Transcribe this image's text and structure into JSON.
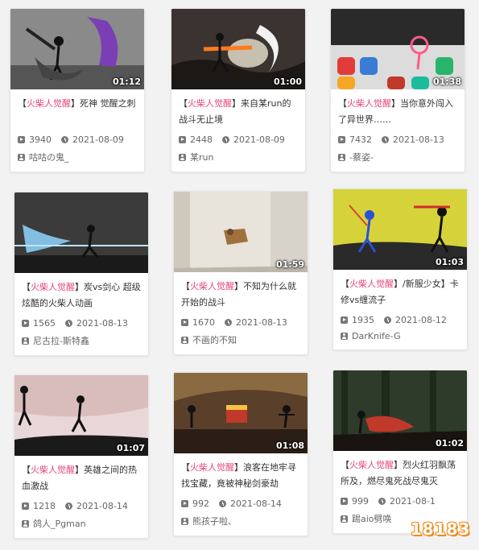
{
  "tag": "火柴人觉醒",
  "cards": [
    {
      "title_pre": "【",
      "tag": "火柴人觉醒",
      "title_post": "】死神 觉醒之刺",
      "duration": "01:12",
      "plays": "3940",
      "date": "2021-08-09",
      "author": "咕咕の鬼_"
    },
    {
      "title_pre": "【",
      "tag": "火柴人觉醒",
      "title_post": "】来自某run的战斗无止境",
      "duration": "01:00",
      "plays": "2448",
      "date": "2021-08-09",
      "author": "某run"
    },
    {
      "title_pre": "【",
      "tag": "火柴人觉醒",
      "title_post": "】当你意外闯入了异世界……",
      "duration": "01:38",
      "plays": "7432",
      "date": "2021-08-13",
      "author": "-蔡姿-"
    },
    {
      "title_pre": "【",
      "tag": "火柴人觉醒",
      "title_post": "】炭vs剑心 超级炫酷的火柴人动画",
      "duration": "",
      "plays": "1565",
      "date": "2021-08-13",
      "author": "尼古拉-斯特鑫"
    },
    {
      "title_pre": "【",
      "tag": "火柴人觉醒",
      "title_post": "】不知为什么就开始的战斗",
      "duration": "01:59",
      "plays": "1670",
      "date": "2021-08-13",
      "author": "不画的不知"
    },
    {
      "title_pre": "【",
      "tag": "火柴人觉醒",
      "title_post": "】/新服少女】卡修vs缠流子",
      "duration": "01:03",
      "plays": "1935",
      "date": "2021-08-12",
      "author": "DarKnife-G"
    },
    {
      "title_pre": "【",
      "tag": "火柴人觉醒",
      "title_post": "】英雄之间的热血激战",
      "duration": "01:07",
      "plays": "1218",
      "date": "2021-08-14",
      "author": "鸽人_Pgman"
    },
    {
      "title_pre": "【",
      "tag": "火柴人觉醒",
      "title_post": "】浪客在地牢寻找宝藏，竟被神秘剑豪劫",
      "duration": "01:08",
      "plays": "992",
      "date": "2021-08-14",
      "author": "熊孩子啦、"
    },
    {
      "title_pre": "【",
      "tag": "火柴人觉醒",
      "title_post": "】烈火红羽飘荡所及，燃尽鬼死战尽鬼灭",
      "duration": "01:02",
      "plays": "999",
      "date": "2021-08-1",
      "author": "踢aio劈唤"
    }
  ],
  "watermark": "18183"
}
